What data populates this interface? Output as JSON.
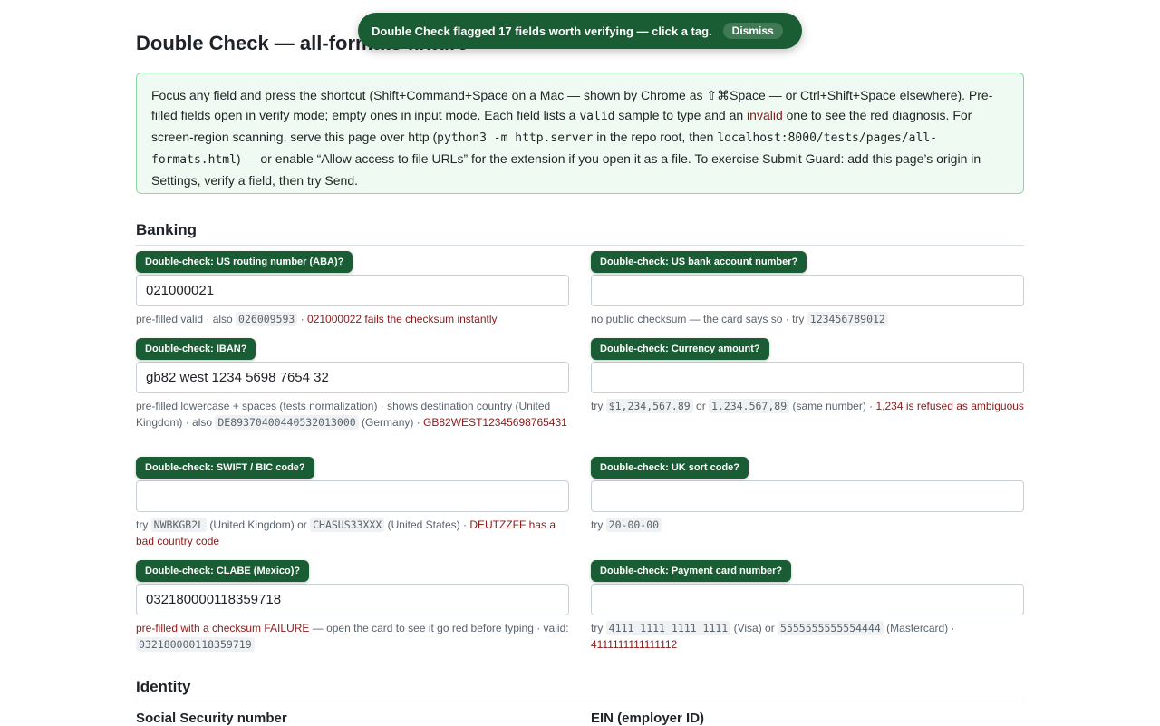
{
  "toast": {
    "message": "Double Check flagged 17 fields worth verifying — click a tag.",
    "dismiss_label": "Dismiss"
  },
  "page_title": "Double Check — all-formats fixture",
  "info": {
    "t1": "Focus any field and press the shortcut (Shift+Command+Space on a Mac — shown by Chrome as ⇧⌘Space — or Ctrl+Shift+Space elsewhere). Pre-filled fields open in verify mode; empty ones in input mode. Each field lists a ",
    "c1": "valid",
    "t2": " sample to type and an ",
    "r1": "invalid",
    "t3": " one to see the red diagnosis. For screen-region scanning, serve this page over http (",
    "c2": "python3 -m http.server",
    "t4": " in the repo root, then ",
    "c3": "localhost:8000/tests/pages/all-formats.html",
    "t5": ") — or enable “Allow access to file URLs” for the extension if you open it as a file. To exercise Submit Guard: add this page’s origin in Settings, verify a field, then try Send."
  },
  "sections": {
    "banking": "Banking",
    "identity": "Identity"
  },
  "fields": {
    "routing": {
      "tag": "Double-check: US routing number (ABA)?",
      "value": "021000021",
      "h1": "pre-filled valid · also ",
      "c1": "026009593",
      "h2": " · ",
      "r1": "021000022 fails the checksum instantly"
    },
    "account": {
      "tag": "Double-check: US bank account number?",
      "value": "",
      "h1": "no public checksum — the card says so · try ",
      "c1": "123456789012"
    },
    "iban": {
      "tag": "Double-check: IBAN?",
      "value": "gb82 west 1234 5698 7654 32",
      "h1": "pre-filled lowercase + spaces (tests normalization) · shows destination country (United Kingdom) · also ",
      "c1": "DE89370400440532013000",
      "h2": " (Germany) · ",
      "r1": "GB82WEST12345698765431"
    },
    "currency": {
      "tag": "Double-check: Currency amount?",
      "value": "",
      "h1": "try ",
      "c1": "$1,234,567.89",
      "h2": " or ",
      "c2": "1.234.567,89",
      "h3": " (same number) · ",
      "r1": "1,234 is refused as ambiguous"
    },
    "swift": {
      "tag": "Double-check: SWIFT / BIC code?",
      "value": "",
      "h1": "try ",
      "c1": "NWBKGB2L",
      "h2": " (United Kingdom) or ",
      "c2": "CHASUS33XXX",
      "h3": " (United States) · ",
      "r1": "DEUTZZFF has a bad country code"
    },
    "sortcode": {
      "tag": "Double-check: UK sort code?",
      "value": "",
      "h1": "try ",
      "c1": "20-00-00"
    },
    "clabe": {
      "tag": "Double-check: CLABE (Mexico)?",
      "value": "032180000118359718",
      "r1": "pre-filled with a checksum FAILURE",
      "h1": " — open the card to see it go red before typing · valid: ",
      "c1": "032180000118359719"
    },
    "card": {
      "tag": "Double-check: Payment card number?",
      "value": "",
      "h1": "try ",
      "c1": "4111 1111 1111 1111",
      "h2": " (Visa) or ",
      "c2": "5555555555554444",
      "h3": " (Mastercard) · ",
      "r1": "4111111111111112"
    }
  },
  "identity_labels": {
    "ssn": "Social Security number",
    "ein": "EIN (employer ID)"
  }
}
